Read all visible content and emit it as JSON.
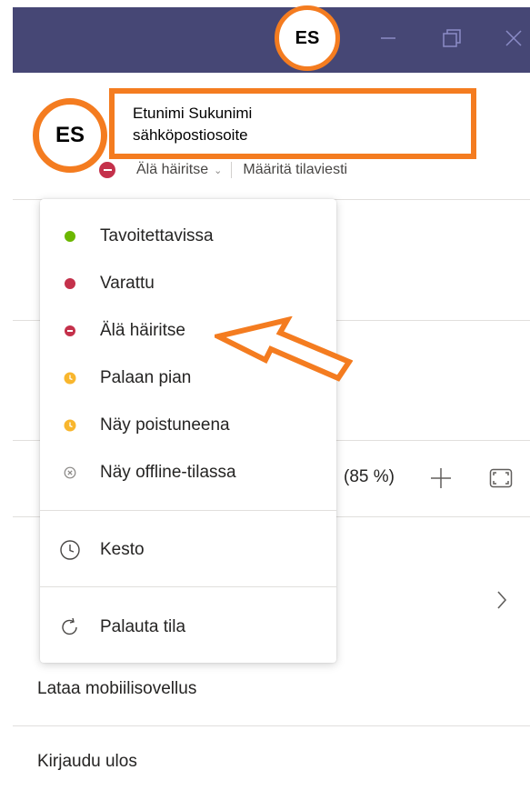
{
  "titlebar": {
    "avatar_initials": "ES"
  },
  "profile": {
    "initials": "ES",
    "name": "Etunimi Sukunimi",
    "email": "sähköpostiosoite",
    "status_label": "Älä häiritse",
    "set_status_message": "Määritä tilaviesti"
  },
  "background": {
    "zoom_text": "(85 %)",
    "download_mobile": "Lataa mobiilisovellus",
    "sign_out": "Kirjaudu ulos"
  },
  "status_menu": {
    "items": [
      {
        "label": "Tavoitettavissa",
        "icon": "available-icon",
        "color": "#6bb700"
      },
      {
        "label": "Varattu",
        "icon": "busy-icon",
        "color": "#c4314b"
      },
      {
        "label": "Älä häiritse",
        "icon": "do-not-disturb-icon",
        "color": "#c4314b"
      },
      {
        "label": "Palaan pian",
        "icon": "be-right-back-icon",
        "color": "#f8b62d"
      },
      {
        "label": "Näy poistuneena",
        "icon": "appear-away-icon",
        "color": "#f8b62d"
      },
      {
        "label": "Näy offline-tilassa",
        "icon": "appear-offline-icon",
        "color": "#8a8886"
      }
    ],
    "duration_label": "Kesto",
    "reset_label": "Palauta tila"
  },
  "colors": {
    "titlebar": "#464775",
    "highlight": "#f47c20"
  }
}
